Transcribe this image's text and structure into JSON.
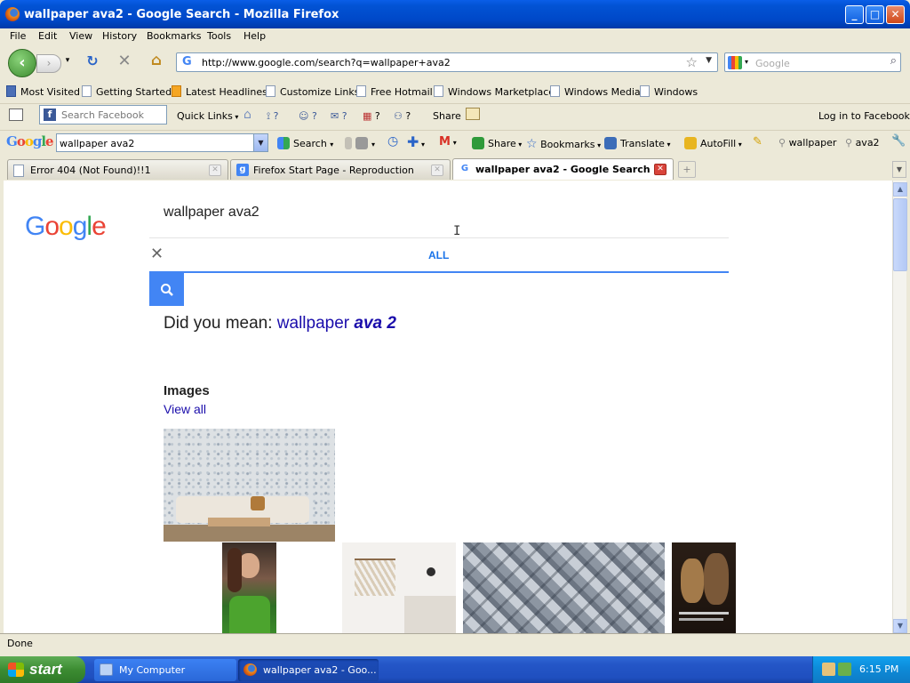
{
  "window": {
    "title": "wallpaper ava2 - Google Search - Mozilla Firefox"
  },
  "menu": [
    "File",
    "Edit",
    "View",
    "History",
    "Bookmarks",
    "Tools",
    "Help"
  ],
  "nav": {
    "url": "http://www.google.com/search?q=wallpaper+ava2",
    "search_placeholder": "Google"
  },
  "bookmarks": [
    "Most Visited",
    "Getting Started",
    "Latest Headlines",
    "Customize Links",
    "Free Hotmail",
    "Windows Marketplace",
    "Windows Media",
    "Windows"
  ],
  "facebook_bar": {
    "search_placeholder": "Search Facebook",
    "quick_links": "Quick Links",
    "share": "Share",
    "login": "Log in to Facebook",
    "q1": "?",
    "q2": "?",
    "q3": "?",
    "q4": "?",
    "q5": "?"
  },
  "google_toolbar": {
    "logo": "Google",
    "query": "wallpaper ava2",
    "search": "Search",
    "share": "Share",
    "bookmarks": "Bookmarks",
    "translate": "Translate",
    "autofill": "AutoFill",
    "word1": "wallpaper",
    "word2": "ava2"
  },
  "tabs": [
    {
      "label": "Error 404 (Not Found)!!1"
    },
    {
      "label": "Firefox Start Page - Reproduction"
    },
    {
      "label": "wallpaper ava2 - Google Search"
    }
  ],
  "page": {
    "logo": "Google",
    "query": "wallpaper ava2",
    "tab_all": "ALL",
    "did_you_mean": "Did you mean:",
    "suggestion_plain": "wallpaper",
    "suggestion_bold": "ava 2",
    "images_heading": "Images",
    "view_all": "View all"
  },
  "status": "Done",
  "taskbar": {
    "start": "start",
    "items": [
      "My Computer",
      "wallpaper ava2 - Goo..."
    ],
    "clock": "6:15 PM"
  },
  "colors": {
    "google_blue": "#4285f4",
    "link": "#1a0dab",
    "xp_blue": "#0054e3"
  }
}
